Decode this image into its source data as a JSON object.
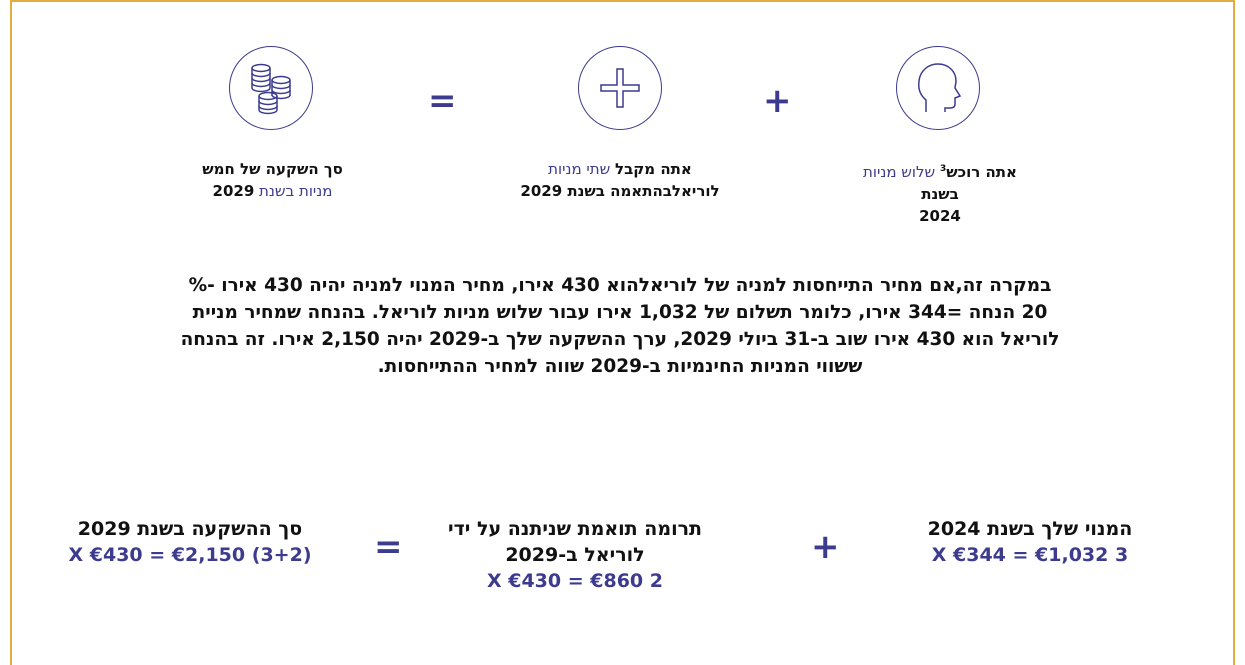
{
  "top": {
    "operators": {
      "plus": "+",
      "equals": "="
    },
    "icons": [
      "head-icon",
      "plus-icon",
      "coins-icon"
    ],
    "col_inherit": {
      "bold_prefix": "אתה רוכש",
      "footnote": "3",
      "accent_mid": " שלוש מניות ",
      "bold_suffix": "בשנת",
      "line2": "2024"
    },
    "col_match": {
      "bold_prefix": "אתה מקבל",
      "accent_mid": " שתי מניות",
      "line2": "לוריאלבהתאמה בשנת 2029"
    },
    "col_total": {
      "bold_line1": "סך השקעה של חמש",
      "accent_line2": "מניות בשנת ",
      "bold_year": "2029"
    }
  },
  "paragraph": {
    "line1": "במקרה זה,אם מחיר התייחסות למניה של לוריאלהוא 430  אירו, מחיר המנוי למניה יהיה 430 אירו -%",
    "line2": "20  הנחה =344  אירו, כלומר תשלום של  1,032  אירו עבור שלוש מניות לוריאל. בהנחה שמחיר מניית",
    "line3": "לוריאל הוא 430 אירו שוב ב-31 ביולי 2029, ערך ההשקעה שלך ב-2029 יהיה 2,150 אירו. זה בהנחה",
    "line4": "ששווי המניות החינמיות ב-2029 שווה למחיר ההתייחסות."
  },
  "bottom": {
    "operators": {
      "plus": "+",
      "equals": "="
    },
    "subscription": {
      "title": "המנוי שלך בשנת 2024",
      "formula": "3 X €344 = €1,032"
    },
    "matching": {
      "title_line1": "תרומה תואמת שניתנה על ידי",
      "title_line2": "לוריאל ב-2029",
      "formula": "2 X €430 = €860"
    },
    "total": {
      "title": "סך ההשקעה בשנת 2029",
      "formula": "(3+2) X €430 = €2,150"
    }
  },
  "colors": {
    "accent": "#3d3b8e",
    "frame": "#e3ac41"
  }
}
